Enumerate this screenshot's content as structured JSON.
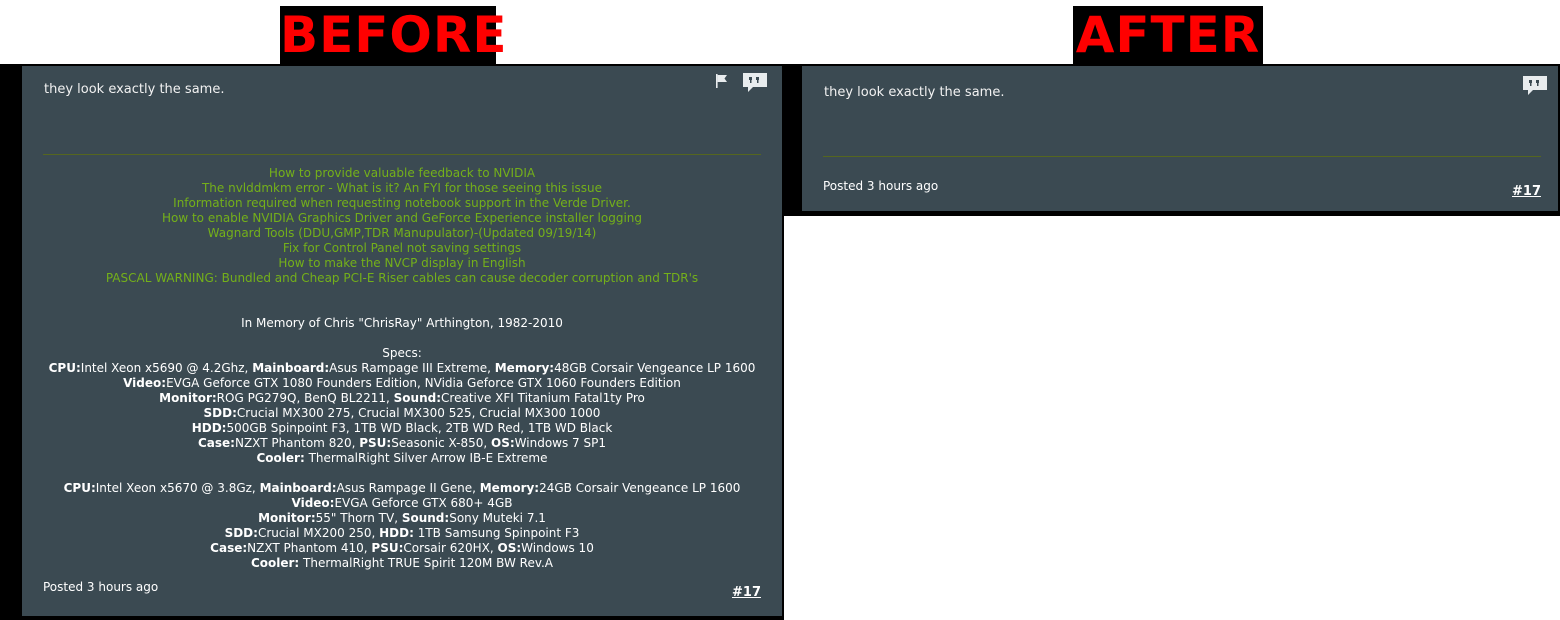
{
  "labels": {
    "before": "BEFORE",
    "after": "AFTER"
  },
  "post": {
    "body": "they look exactly the same.",
    "posted": "Posted 3 hours ago",
    "number": "#17"
  },
  "signature": {
    "links": [
      "How to provide valuable feedback to NVIDIA",
      "The nvlddmkm error - What is it? An FYI for those seeing this issue",
      "Information required when requesting notebook support in the Verde Driver.",
      "How to enable NVIDIA Graphics Driver and GeForce Experience installer logging",
      "Wagnard Tools (DDU,GMP,TDR Manupulator)-(Updated 09/19/14)",
      "Fix for Control Panel not saving settings",
      "How to make the NVCP display in English",
      "PASCAL WARNING: Bundled and Cheap PCI-E Riser cables can cause decoder corruption and TDR's"
    ],
    "memory": "In Memory of Chris \"ChrisRay\" Arthington, 1982-2010",
    "specs_title": "Specs:",
    "rig1": [
      [
        {
          "k": "CPU:",
          "v": "Intel Xeon x5690 @ 4.2Ghz, "
        },
        {
          "k": "Mainboard:",
          "v": "Asus Rampage III Extreme, "
        },
        {
          "k": "Memory:",
          "v": "48GB Corsair Vengeance LP 1600"
        }
      ],
      [
        {
          "k": "Video:",
          "v": "EVGA Geforce GTX 1080 Founders Edition, NVidia Geforce GTX 1060 Founders Edition"
        }
      ],
      [
        {
          "k": "Monitor:",
          "v": "ROG PG279Q, BenQ BL2211, "
        },
        {
          "k": "Sound:",
          "v": "Creative XFI Titanium Fatal1ty Pro"
        }
      ],
      [
        {
          "k": "SDD:",
          "v": "Crucial MX300 275, Crucial MX300 525, Crucial MX300 1000"
        }
      ],
      [
        {
          "k": "HDD:",
          "v": "500GB Spinpoint F3, 1TB WD Black, 2TB WD Red, 1TB WD Black"
        }
      ],
      [
        {
          "k": "Case:",
          "v": "NZXT Phantom 820, "
        },
        {
          "k": "PSU:",
          "v": "Seasonic X-850, "
        },
        {
          "k": "OS:",
          "v": "Windows 7 SP1"
        }
      ],
      [
        {
          "k": "Cooler:",
          "v": " ThermalRight Silver Arrow IB-E Extreme"
        }
      ]
    ],
    "rig2": [
      [
        {
          "k": "CPU:",
          "v": "Intel Xeon x5670 @ 3.8Gz, "
        },
        {
          "k": "Mainboard:",
          "v": "Asus Rampage II Gene, "
        },
        {
          "k": "Memory:",
          "v": "24GB Corsair Vengeance LP 1600"
        }
      ],
      [
        {
          "k": "Video:",
          "v": "EVGA Geforce GTX 680+ 4GB"
        }
      ],
      [
        {
          "k": "Monitor:",
          "v": "55\" Thorn TV, "
        },
        {
          "k": "Sound:",
          "v": "Sony Muteki 7.1"
        }
      ],
      [
        {
          "k": "SDD:",
          "v": "Crucial MX200 250, "
        },
        {
          "k": "HDD:",
          "v": " 1TB Samsung Spinpoint F3"
        }
      ],
      [
        {
          "k": "Case:",
          "v": "NZXT Phantom 410, "
        },
        {
          "k": "PSU:",
          "v": "Corsair 620HX, "
        },
        {
          "k": "OS:",
          "v": "Windows 10"
        }
      ],
      [
        {
          "k": "Cooler:",
          "v": " ThermalRight TRUE Spirit 120M BW Rev.A"
        }
      ]
    ]
  },
  "colors": {
    "card": "#3b4a52",
    "link": "#74b01a",
    "label": "#ff0000"
  },
  "icons": [
    "flag-icon",
    "quote-icon"
  ]
}
